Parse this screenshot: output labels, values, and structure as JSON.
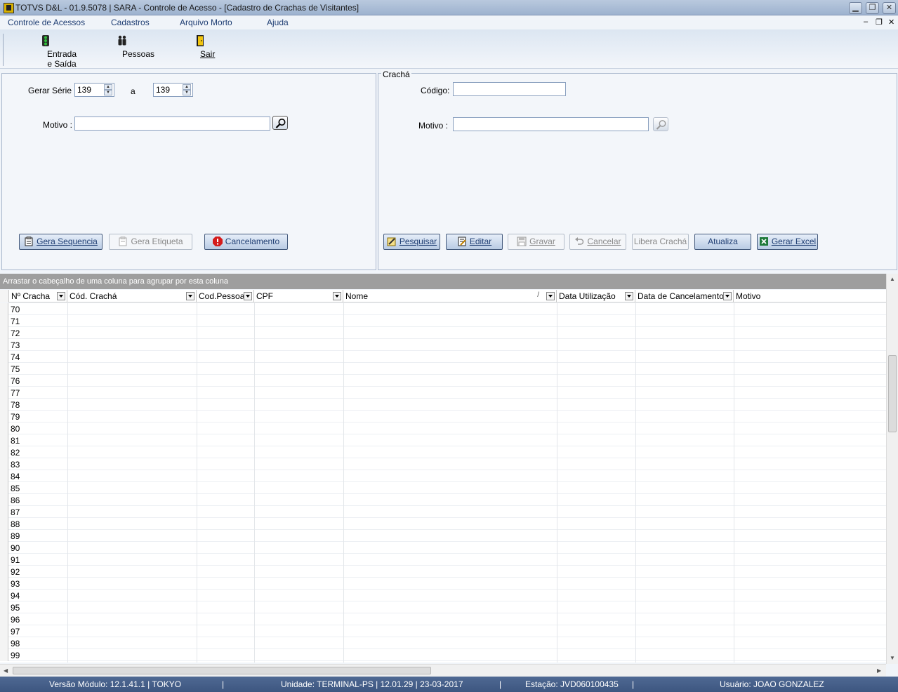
{
  "window": {
    "title": "TOTVS D&L - 01.9.5078 | SARA - Controle de Acesso - [Cadastro de Crachas de Visitantes]",
    "minimize": "▁",
    "restore": "❐",
    "close": "✕"
  },
  "menu": {
    "items": [
      "Controle de Acessos",
      "Cadastros",
      "Arquivo Morto",
      "Ajuda"
    ],
    "mdi_minimize": "–",
    "mdi_restore": "❐",
    "mdi_close": "✕"
  },
  "toolbar": {
    "entrada_saida": "Entrada e Saída",
    "pessoas": "Pessoas",
    "sair": "Sair"
  },
  "left_panel": {
    "gerar_serie_label": "Gerar Série :",
    "serie_from": "139",
    "a_label": "a",
    "serie_to": "139",
    "motivo_label": "Motivo :",
    "motivo_value": "",
    "gera_sequencia": "Gera Sequencia",
    "gera_etiqueta": "Gera Etiqueta",
    "cancelamento": "Cancelamento"
  },
  "right_panel": {
    "legend": "Crachá",
    "codigo_label": "Código:",
    "codigo_value": "",
    "motivo_label": "Motivo :",
    "motivo_value": "",
    "pesquisar": "Pesquisar",
    "editar": "Editar",
    "gravar": "Gravar",
    "cancelar": "Cancelar",
    "libera_cracha": "Libera Crachá",
    "atualiza": "Atualiza",
    "gerar_excel": "Gerar Excel"
  },
  "grid": {
    "group_hint": "Arrastar o cabeçalho de uma coluna para agrupar por esta coluna",
    "columns": [
      "Nº Cracha",
      "Cód. Crachá",
      "Cod.Pessoa",
      "CPF",
      "Nome",
      "Data Utilização",
      "Data de Cancelamento",
      "Motivo"
    ],
    "sort_marker": "/",
    "rows": [
      "70",
      "71",
      "72",
      "73",
      "74",
      "75",
      "76",
      "77",
      "78",
      "79",
      "80",
      "81",
      "82",
      "83",
      "84",
      "85",
      "86",
      "87",
      "88",
      "89",
      "90",
      "91",
      "92",
      "93",
      "94",
      "95",
      "96",
      "97",
      "98",
      "99"
    ]
  },
  "status": {
    "versao": "Versão Módulo:  12.1.41.1  |  TOKYO",
    "sep1": "|",
    "unidade": "Unidade: TERMINAL-PS | 12.01.29 | 23-03-2017",
    "sep2": "|",
    "estacao": "Estação: JVD060100435",
    "sep3": "|",
    "usuario": "Usuário: JOAO GONZALEZ"
  }
}
